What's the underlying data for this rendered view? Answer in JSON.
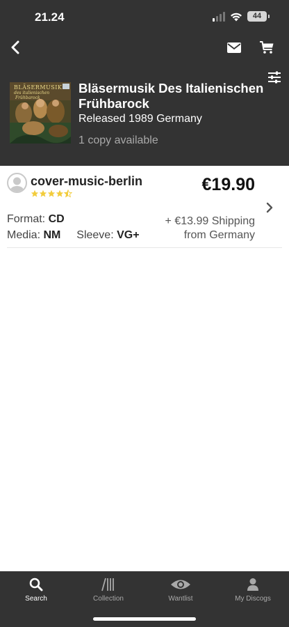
{
  "status_bar": {
    "time": "21.24",
    "battery": "44"
  },
  "release": {
    "cover_text": [
      "BLÄSERMUSIK",
      "des italienischen",
      "Frühbarock"
    ],
    "title": "Bläsermusik Des Italienischen Frühbarock",
    "info": "Released 1989 Germany",
    "copies": "1 copy available"
  },
  "listing": {
    "seller": "cover-music-berlin",
    "rating_stars": 4.5,
    "price": "€19.90",
    "format_label": "Format:",
    "format_value": "CD",
    "media_label": "Media:",
    "media_value": "NM",
    "sleeve_label": "Sleeve:",
    "sleeve_value": "VG+",
    "shipping_line1": "+ €13.99 Shipping",
    "shipping_line2": "from Germany"
  },
  "tabs": [
    {
      "label": "Search",
      "icon": "search-icon",
      "active": true
    },
    {
      "label": "Collection",
      "icon": "collection-icon",
      "active": false
    },
    {
      "label": "Wantlist",
      "icon": "eye-icon",
      "active": false
    },
    {
      "label": "My Discogs",
      "icon": "user-icon",
      "active": false
    }
  ],
  "colors": {
    "header_bg": "#333333",
    "star": "#f2cc3c",
    "tab_active": "#ffffff",
    "tab_inactive": "#a9a9a9"
  }
}
